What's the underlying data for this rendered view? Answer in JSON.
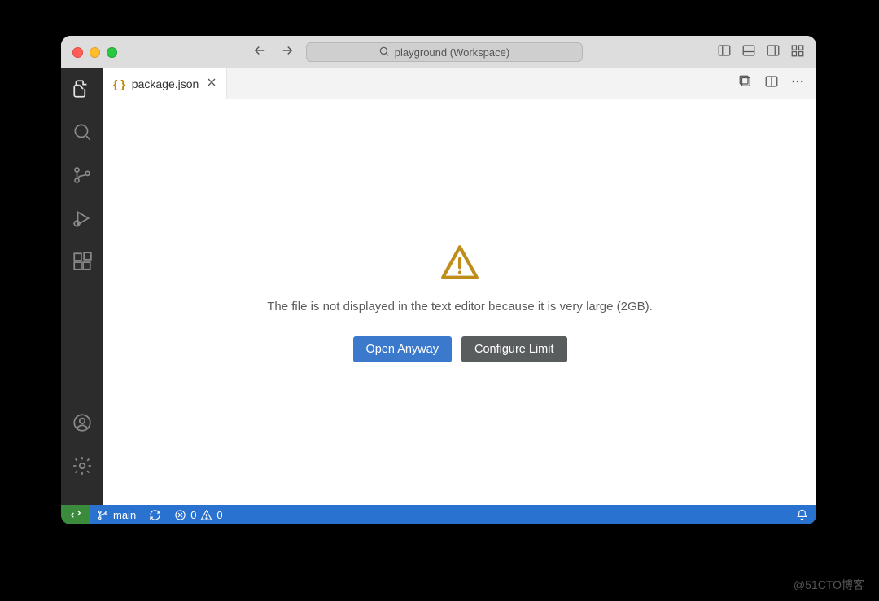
{
  "titlebar": {
    "search_text": "playground (Workspace)"
  },
  "tab": {
    "filename": "package.json",
    "icon_glyph": "{ }"
  },
  "editor": {
    "message": "The file is not displayed in the text editor because it is very large (2GB).",
    "open_anyway": "Open Anyway",
    "configure_limit": "Configure Limit"
  },
  "status": {
    "branch": "main",
    "errors": "0",
    "warnings": "0"
  },
  "watermark": "@51CTO博客"
}
